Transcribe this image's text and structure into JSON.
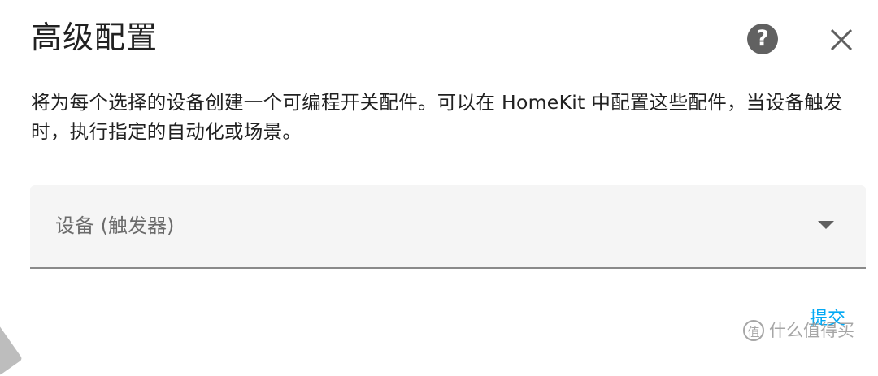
{
  "dialog": {
    "title": "高级配置",
    "help_icon": "question-circle-icon",
    "help_glyph": "?",
    "close_icon": "close-icon",
    "description": "将为每个选择的设备创建一个可编程开关配件。可以在 HomeKit 中配置这些配件，当设备触发时，执行指定的自动化或场景。",
    "device_select": {
      "label": "设备 (触发器)",
      "icon": "chevron-down-icon"
    },
    "submit_label": "提交"
  },
  "watermark": {
    "logo_text": "值",
    "text": "什么值得买"
  },
  "colors": {
    "accent": "#03a9f4",
    "help_button": "#616161",
    "field_background": "#f5f5f5"
  }
}
